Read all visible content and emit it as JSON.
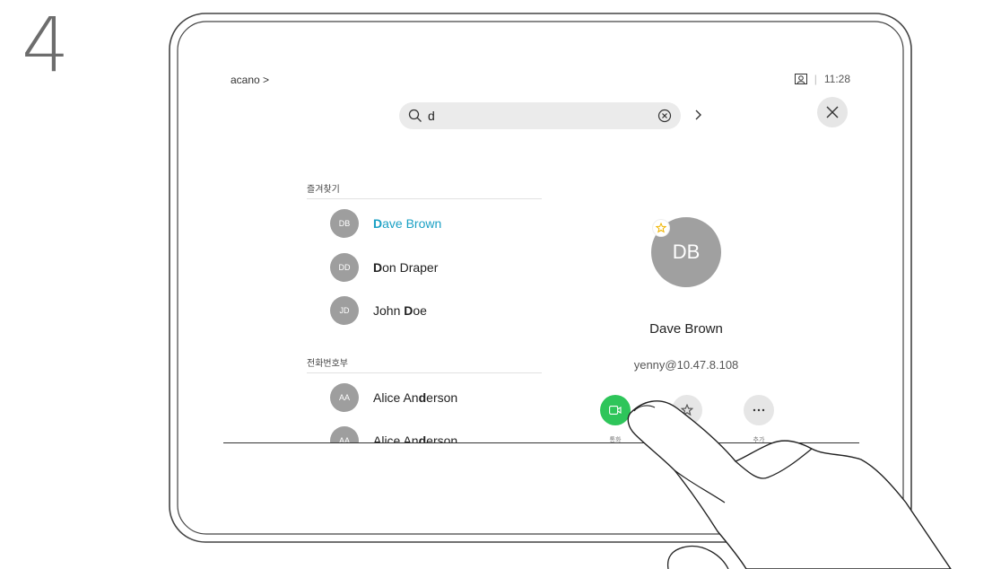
{
  "step_number": "4",
  "topbar": {
    "breadcrumb": "acano >",
    "separator": "|",
    "time": "11:28"
  },
  "search": {
    "query": "d"
  },
  "favorites": {
    "header": "즐겨찾기",
    "items": [
      {
        "initials": "DB",
        "match": "D",
        "rest": "ave Brown"
      },
      {
        "initials": "DD",
        "match": "D",
        "rest": "on Draper"
      },
      {
        "initials": "JD",
        "prefix": "John ",
        "match": "D",
        "rest": "oe"
      }
    ]
  },
  "directory": {
    "header": "전화번호부",
    "items": [
      {
        "initials": "AA",
        "prefix": "Alice An",
        "match": "d",
        "rest": "erson"
      },
      {
        "initials": "AA",
        "prefix": "Alice An",
        "match": "d",
        "rest": "erson"
      }
    ]
  },
  "contact_detail": {
    "initials": "DB",
    "name": "Dave Brown",
    "address": "yenny@10.47.8.108",
    "actions": [
      {
        "label": "통화",
        "icon": "video-call-icon"
      },
      {
        "label": "",
        "icon": "star-icon"
      },
      {
        "label": "추가",
        "icon": "more-icon"
      }
    ]
  },
  "colors": {
    "call_green": "#2ec55a",
    "highlight_blue": "#1aa0c4",
    "avatar_gray": "#9e9e9e",
    "favorite_star": "#f0b400"
  }
}
